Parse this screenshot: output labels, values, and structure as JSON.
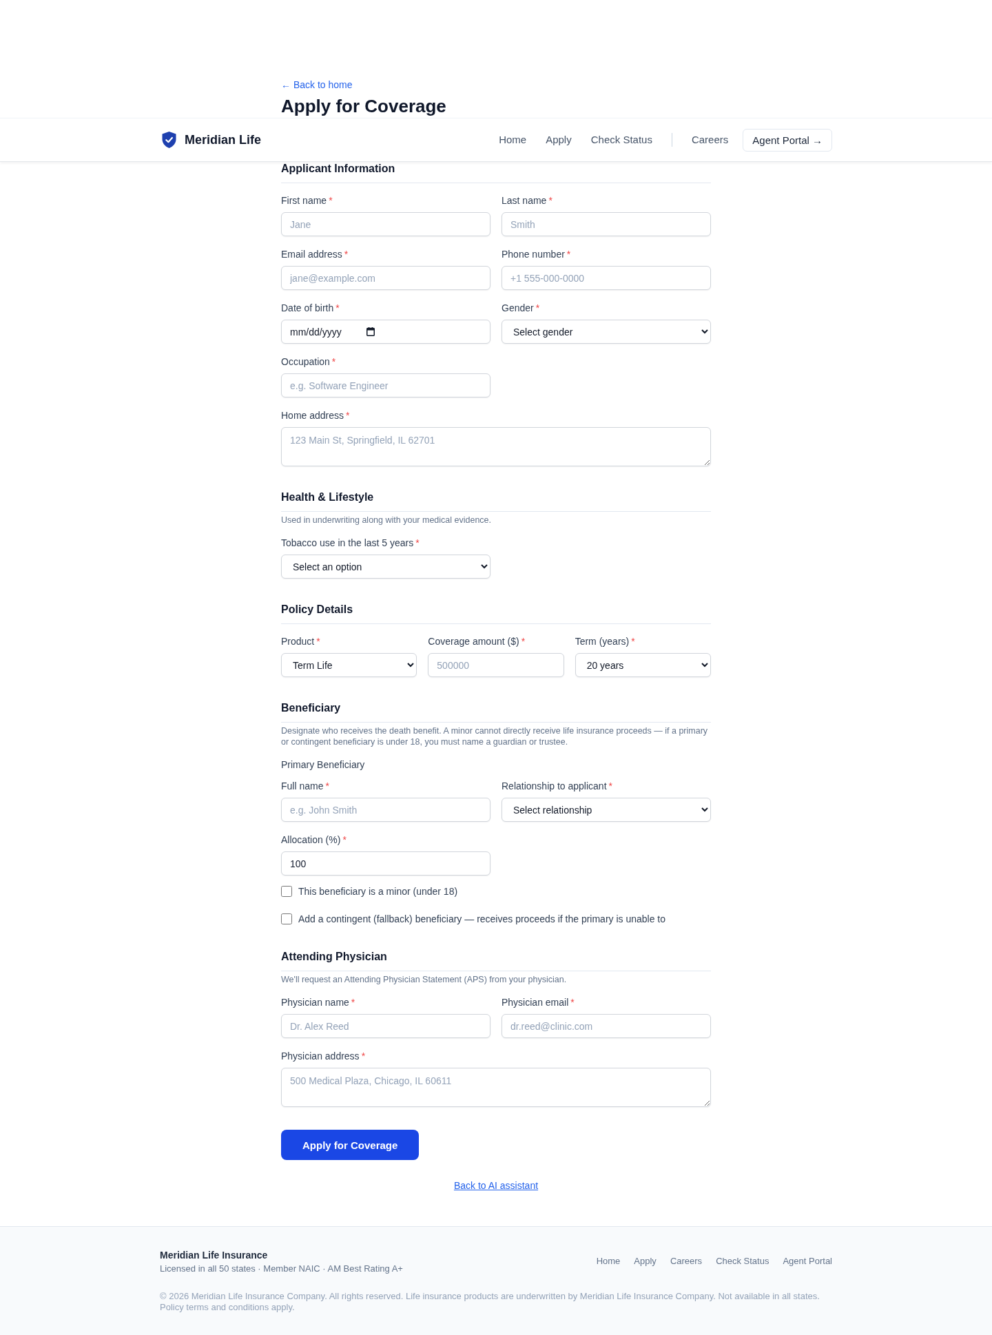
{
  "back_link": "← Back to home",
  "page_title": "Apply for Coverage",
  "header": {
    "brand": "Meridian Life",
    "nav": [
      "Home",
      "Apply",
      "Check Status"
    ],
    "secondary_nav": [
      "Careers"
    ],
    "agent_portal_button": "Agent Portal →"
  },
  "sections": [
    {
      "title": "Applicant Information",
      "rows": [
        [
          {
            "kind": "text",
            "label": "First name",
            "required_mark": "*",
            "placeholder": "Jane"
          },
          {
            "kind": "text",
            "label": "Last name",
            "required_mark": "*",
            "placeholder": "Smith"
          }
        ],
        [
          {
            "kind": "text",
            "label": "Email address",
            "required_mark": "*",
            "placeholder": "jane@example.com"
          },
          {
            "kind": "text",
            "label": "Phone number",
            "required_mark": "*",
            "placeholder": "+1 555-000-0000"
          }
        ],
        [
          {
            "kind": "date",
            "label": "Date of birth",
            "required_mark": "*",
            "placeholder": "mm/dd/yyyy"
          },
          {
            "kind": "select",
            "label": "Gender",
            "required_mark": "*",
            "value": "Select gender"
          }
        ],
        [
          {
            "kind": "text",
            "label": "Occupation",
            "required_mark": "*",
            "placeholder": "e.g. Software Engineer"
          }
        ],
        [
          {
            "kind": "textarea",
            "label": "Home address",
            "required_mark": "*",
            "placeholder": "123 Main St, Springfield, IL 62701"
          }
        ]
      ]
    },
    {
      "title": "Health & Lifestyle",
      "description": "Used in underwriting along with your medical evidence.",
      "rows": [
        [
          {
            "kind": "select",
            "label": "Tobacco use in the last 5 years",
            "required_mark": "*",
            "value": "Select an option"
          }
        ]
      ]
    },
    {
      "title": "Policy Details",
      "rows": [
        [
          {
            "kind": "select",
            "label": "Product",
            "required_mark": "*",
            "value": "Term Life"
          },
          {
            "kind": "text",
            "label": "Coverage amount ($)",
            "required_mark": "*",
            "placeholder": "500000"
          },
          {
            "kind": "select",
            "label": "Term (years)",
            "required_mark": "*",
            "value": "20 years"
          }
        ]
      ]
    },
    {
      "title": "Beneficiary",
      "description": "Designate who receives the death benefit. A minor cannot directly receive life insurance proceeds — if a primary or contingent beneficiary is under 18, you must name a guardian or trustee.",
      "subtitle": "Primary Beneficiary",
      "rows": [
        [
          {
            "kind": "text",
            "label": "Full name",
            "required_mark": "*",
            "placeholder": "e.g. John Smith"
          },
          {
            "kind": "select",
            "label": "Relationship to applicant",
            "required_mark": "*",
            "value": "Select relationship"
          }
        ],
        [
          {
            "kind": "text",
            "label": "Allocation (%)",
            "required_mark": "*",
            "value": "100"
          }
        ],
        [
          {
            "kind": "checkbox",
            "label": "This beneficiary is a minor (under 18)",
            "checked": false
          }
        ],
        [
          {
            "kind": "checkbox",
            "label": "Add a contingent (fallback) beneficiary — receives proceeds if the primary is unable to",
            "checked": false
          }
        ]
      ]
    },
    {
      "title": "Attending Physician",
      "description": "We'll request an Attending Physician Statement (APS) from your physician.",
      "rows": [
        [
          {
            "kind": "text",
            "label": "Physician name",
            "required_mark": "*",
            "placeholder": "Dr. Alex Reed"
          },
          {
            "kind": "text",
            "label": "Physician email",
            "required_mark": "*",
            "placeholder": "dr.reed@clinic.com"
          }
        ],
        [
          {
            "kind": "textarea",
            "label": "Physician address",
            "required_mark": "*",
            "placeholder": "500 Medical Plaza, Chicago, IL 60611"
          }
        ]
      ]
    }
  ],
  "submit_button": "Apply for Coverage",
  "assistant_link": "Back to AI assistant",
  "footer": {
    "brand": "Meridian Life Insurance",
    "tagline": "Licensed in all 50 states · Member NAIC · AM Best Rating A+",
    "links": [
      "Home",
      "Apply",
      "Careers",
      "Check Status",
      "Agent Portal"
    ],
    "copyright": "© 2026 Meridian Life Insurance Company. All rights reserved. Life insurance products are underwritten by Meridian Life Insurance Company. Not available in all states. Policy terms and conditions apply."
  }
}
